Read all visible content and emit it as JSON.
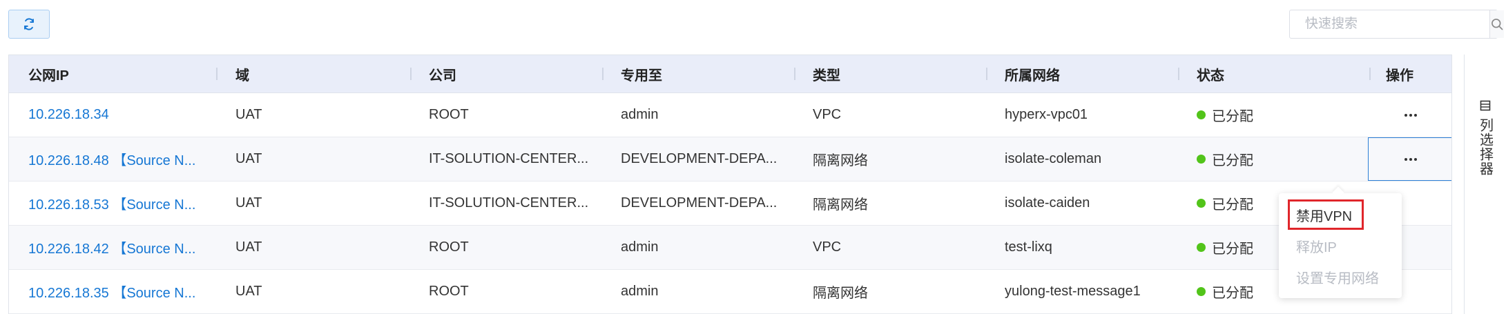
{
  "toolbar": {
    "search_placeholder": "快速搜索"
  },
  "table": {
    "headers": [
      "公网IP",
      "域",
      "公司",
      "专用至",
      "类型",
      "所属网络",
      "状态",
      "操作"
    ],
    "rows": [
      {
        "ip": "10.226.18.34",
        "domain": "UAT",
        "company": "ROOT",
        "dedicated": "admin",
        "type": "VPC",
        "network": "hyperx-vpc01",
        "status": "已分配"
      },
      {
        "ip": "10.226.18.48 【Source N...",
        "domain": "UAT",
        "company": "IT-SOLUTION-CENTER...",
        "dedicated": "DEVELOPMENT-DEPA...",
        "type": "隔离网络",
        "network": "isolate-coleman",
        "status": "已分配"
      },
      {
        "ip": "10.226.18.53 【Source N...",
        "domain": "UAT",
        "company": "IT-SOLUTION-CENTER...",
        "dedicated": "DEVELOPMENT-DEPA...",
        "type": "隔离网络",
        "network": "isolate-caiden",
        "status": "已分配"
      },
      {
        "ip": "10.226.18.42 【Source N...",
        "domain": "UAT",
        "company": "ROOT",
        "dedicated": "admin",
        "type": "VPC",
        "network": "test-lixq",
        "status": "已分配"
      },
      {
        "ip": "10.226.18.35 【Source N...",
        "domain": "UAT",
        "company": "ROOT",
        "dedicated": "admin",
        "type": "隔离网络",
        "network": "yulong-test-message1",
        "status": "已分配"
      }
    ]
  },
  "dropdown": {
    "items": [
      {
        "label": "禁用VPN",
        "enabled": true
      },
      {
        "label": "释放IP",
        "enabled": false
      },
      {
        "label": "设置专用网络",
        "enabled": false
      }
    ]
  },
  "column_chooser": {
    "label": "列选择器"
  },
  "colors": {
    "link": "#1677d4",
    "status_ok": "#52c41a",
    "highlight": "#e0262b",
    "header_bg": "#e9edf9"
  }
}
